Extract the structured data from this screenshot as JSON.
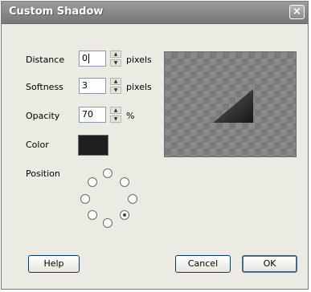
{
  "window": {
    "title": "Custom Shadow",
    "close_label": "×"
  },
  "distance": {
    "label": "Distance",
    "value": "0",
    "unit": "pixels"
  },
  "softness": {
    "label": "Softness",
    "value": "3",
    "unit": "pixels"
  },
  "opacity": {
    "label": "Opacity",
    "value": "70",
    "unit": "%"
  },
  "color": {
    "label": "Color",
    "value": "#1f1f1f"
  },
  "position": {
    "label": "Position",
    "selected": "bottom-right"
  },
  "buttons": {
    "help": "Help",
    "cancel": "Cancel",
    "ok": "OK"
  },
  "icons": {
    "spin_up": "▲",
    "spin_down": "▼"
  }
}
